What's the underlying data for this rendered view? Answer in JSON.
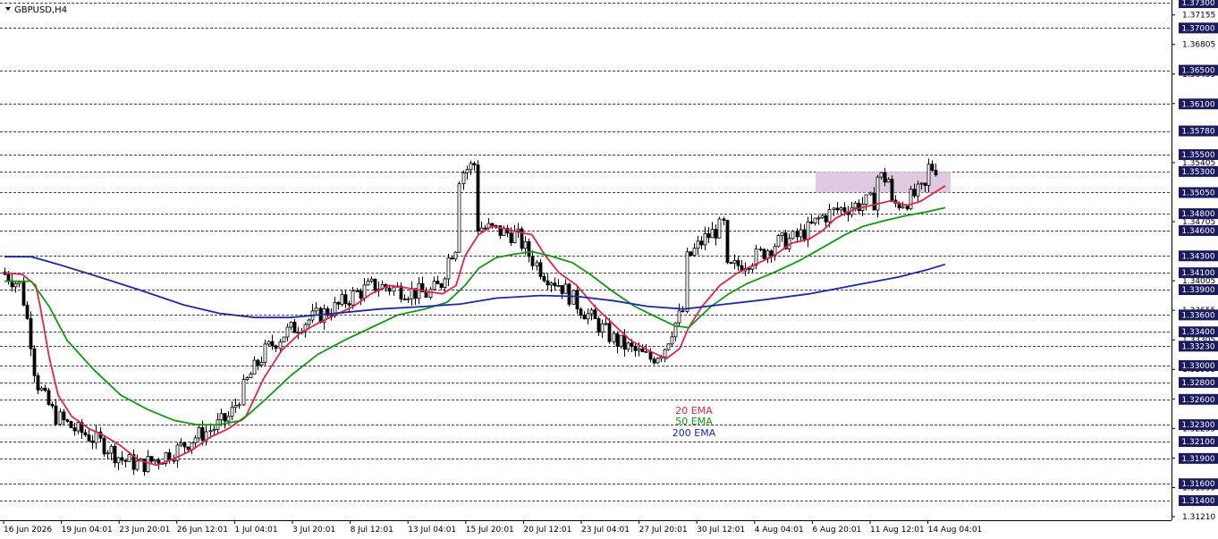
{
  "chart_data": {
    "type": "candlestick",
    "title": "GBPUSD,H4",
    "symbol": "GBPUSD",
    "timeframe": "H4",
    "ylim": [
      1.3121,
      1.373
    ],
    "grid": false,
    "legend_placement": "bottom-center",
    "colors": {
      "background": "#ffffff",
      "candle": "#000000",
      "level_line": "#000000",
      "level_label_bg": "#1a1a5e",
      "level_label_text": "#ffffff",
      "zone_fill": "#d8c0dc",
      "ema20": "#e0244c",
      "ema50": "#119911",
      "ema200": "#1a2aa6"
    },
    "x_tick_labels": [
      "16 Jun 2026",
      "19 Jun 04:01",
      "23 Jun 20:01",
      "26 Jun 12:01",
      "1 Jul 04:01",
      "3 Jul 20:01",
      "8 Jul 12:01",
      "13 Jul 04:01",
      "15 Jul 20:01",
      "20 Jul 12:01",
      "23 Jul 04:01",
      "27 Jul 20:01",
      "30 Jul 12:01",
      "4 Aug 04:01",
      "6 Aug 20:01",
      "11 Aug 12:01",
      "14 Aug 04:01"
    ],
    "y_tick_labels": [
      "1.37155",
      "1.36805",
      "1.36455",
      "1.36105",
      "1.35405",
      "1.34705",
      "1.34005",
      "1.33655",
      "1.33305",
      "1.32955",
      "1.32605",
      "1.32255",
      "1.31905",
      "1.31555",
      "1.31210"
    ],
    "horizontal_levels": [
      "1.37300",
      "1.37000",
      "1.36500",
      "1.36100",
      "1.35780",
      "1.35500",
      "1.35300",
      "1.35050",
      "1.34800",
      "1.34600",
      "1.34300",
      "1.34100",
      "1.33900",
      "1.33600",
      "1.33400",
      "1.33230",
      "1.33000",
      "1.32800",
      "1.32600",
      "1.32300",
      "1.32100",
      "1.31900",
      "1.31600",
      "1.31400"
    ],
    "zone": {
      "from_label": "6 Aug 20:01",
      "to_label": "14 Aug 04:01",
      "low": 1.3505,
      "high": 1.353
    },
    "series": [
      {
        "name": "20 EMA",
        "color": "#e0244c",
        "points": [
          [
            0,
            1.341
          ],
          [
            20,
            1.3408
          ],
          [
            35,
            1.3395
          ],
          [
            40,
            1.337
          ],
          [
            50,
            1.331
          ],
          [
            60,
            1.3265
          ],
          [
            75,
            1.324
          ],
          [
            95,
            1.3225
          ],
          [
            110,
            1.3218
          ],
          [
            130,
            1.3205
          ],
          [
            150,
            1.3188
          ],
          [
            170,
            1.3182
          ],
          [
            190,
            1.319
          ],
          [
            210,
            1.32
          ],
          [
            230,
            1.3215
          ],
          [
            250,
            1.3225
          ],
          [
            270,
            1.324
          ],
          [
            290,
            1.3285
          ],
          [
            310,
            1.3318
          ],
          [
            330,
            1.3338
          ],
          [
            350,
            1.335
          ],
          [
            370,
            1.336
          ],
          [
            390,
            1.337
          ],
          [
            410,
            1.3385
          ],
          [
            430,
            1.3395
          ],
          [
            450,
            1.3392
          ],
          [
            470,
            1.3388
          ],
          [
            490,
            1.3385
          ],
          [
            505,
            1.3395
          ],
          [
            515,
            1.343
          ],
          [
            530,
            1.3455
          ],
          [
            545,
            1.3465
          ],
          [
            560,
            1.3462
          ],
          [
            575,
            1.3458
          ],
          [
            590,
            1.3455
          ],
          [
            605,
            1.343
          ],
          [
            620,
            1.341
          ],
          [
            640,
            1.3395
          ],
          [
            660,
            1.337
          ],
          [
            680,
            1.335
          ],
          [
            700,
            1.333
          ],
          [
            720,
            1.3318
          ],
          [
            740,
            1.3308
          ],
          [
            755,
            1.332
          ],
          [
            765,
            1.3345
          ],
          [
            780,
            1.337
          ],
          [
            800,
            1.3395
          ],
          [
            820,
            1.341
          ],
          [
            840,
            1.342
          ],
          [
            860,
            1.343
          ],
          [
            880,
            1.3445
          ],
          [
            900,
            1.345
          ],
          [
            915,
            1.346
          ],
          [
            930,
            1.3475
          ],
          [
            950,
            1.3485
          ],
          [
            970,
            1.349
          ],
          [
            990,
            1.3495
          ],
          [
            1010,
            1.349
          ],
          [
            1025,
            1.3495
          ],
          [
            1040,
            1.3505
          ],
          [
            1052,
            1.3513
          ]
        ]
      },
      {
        "name": "50 EMA",
        "color": "#119911",
        "points": [
          [
            0,
            1.34
          ],
          [
            30,
            1.34
          ],
          [
            50,
            1.337
          ],
          [
            70,
            1.333
          ],
          [
            100,
            1.3295
          ],
          [
            130,
            1.3265
          ],
          [
            160,
            1.3248
          ],
          [
            190,
            1.3235
          ],
          [
            215,
            1.323
          ],
          [
            240,
            1.323
          ],
          [
            265,
            1.3235
          ],
          [
            290,
            1.3258
          ],
          [
            320,
            1.3288
          ],
          [
            350,
            1.3313
          ],
          [
            380,
            1.333
          ],
          [
            410,
            1.3345
          ],
          [
            440,
            1.336
          ],
          [
            470,
            1.3367
          ],
          [
            495,
            1.3375
          ],
          [
            515,
            1.3395
          ],
          [
            530,
            1.3415
          ],
          [
            550,
            1.3428
          ],
          [
            570,
            1.3432
          ],
          [
            590,
            1.3435
          ],
          [
            610,
            1.343
          ],
          [
            635,
            1.3422
          ],
          [
            655,
            1.3408
          ],
          [
            680,
            1.3388
          ],
          [
            705,
            1.337
          ],
          [
            730,
            1.3357
          ],
          [
            750,
            1.3347
          ],
          [
            765,
            1.3345
          ],
          [
            790,
            1.337
          ],
          [
            810,
            1.3385
          ],
          [
            830,
            1.3397
          ],
          [
            860,
            1.341
          ],
          [
            890,
            1.3425
          ],
          [
            915,
            1.344
          ],
          [
            940,
            1.3455
          ],
          [
            960,
            1.3465
          ],
          [
            985,
            1.3472
          ],
          [
            1010,
            1.3478
          ],
          [
            1030,
            1.3482
          ],
          [
            1052,
            1.3487
          ]
        ]
      },
      {
        "name": "200 EMA",
        "color": "#1a2aa6",
        "points": [
          [
            0,
            1.3429
          ],
          [
            30,
            1.3429
          ],
          [
            60,
            1.342
          ],
          [
            100,
            1.3407
          ],
          [
            150,
            1.339
          ],
          [
            200,
            1.3372
          ],
          [
            240,
            1.3362
          ],
          [
            280,
            1.3357
          ],
          [
            320,
            1.3357
          ],
          [
            370,
            1.3362
          ],
          [
            420,
            1.3367
          ],
          [
            470,
            1.337
          ],
          [
            510,
            1.3373
          ],
          [
            550,
            1.338
          ],
          [
            600,
            1.3383
          ],
          [
            640,
            1.3382
          ],
          [
            680,
            1.3377
          ],
          [
            720,
            1.337
          ],
          [
            760,
            1.3367
          ],
          [
            800,
            1.3372
          ],
          [
            850,
            1.3378
          ],
          [
            900,
            1.3385
          ],
          [
            950,
            1.3395
          ],
          [
            1000,
            1.3405
          ],
          [
            1030,
            1.3413
          ],
          [
            1052,
            1.342
          ]
        ]
      }
    ],
    "legend": [
      {
        "label": "20 EMA",
        "color": "#e0244c"
      },
      {
        "label": "50 EMA",
        "color": "#119911"
      },
      {
        "label": "200 EMA",
        "color": "#1a2aa6"
      }
    ]
  }
}
